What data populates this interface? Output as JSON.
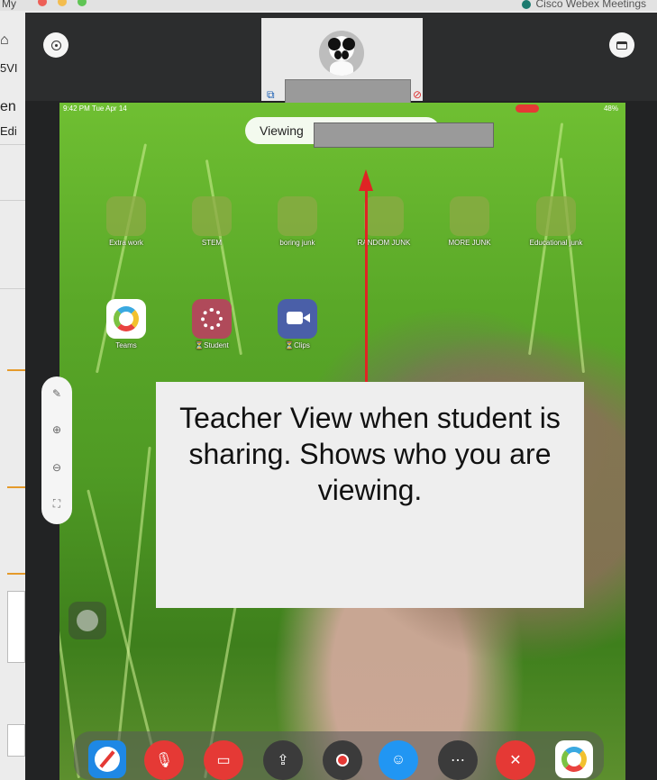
{
  "mac": {
    "app_name": "My",
    "right_title": "Cisco Webex Meetings",
    "side_fragments": [
      "5VI",
      "en",
      "Edi"
    ]
  },
  "participant": {
    "name": ""
  },
  "screen": {
    "status_time": "9:42 PM  Tue Apr 14",
    "status_right": "48%",
    "viewing_prefix": "Viewing"
  },
  "home": {
    "folders": [
      {
        "label": "Extra work"
      },
      {
        "label": "STEM"
      },
      {
        "label": "boring junk"
      },
      {
        "label": "RANDOM JUNK"
      },
      {
        "label": "MORE JUNK"
      },
      {
        "label": "Educational junk"
      }
    ],
    "apps": [
      {
        "label": "Teams"
      },
      {
        "label": "⏳Student"
      },
      {
        "label": "⏳Clips"
      }
    ]
  },
  "annotation": {
    "text": "Teacher View when student is sharing. Shows who you are viewing."
  },
  "colors": {
    "arrow": "#e02424",
    "mute": "#e53935",
    "participants": "#2196f3"
  },
  "icons": [
    "info-icon",
    "layout-icon",
    "share-icon",
    "mute-icon",
    "zoom-in-icon",
    "zoom-out-icon",
    "fit-icon",
    "pen-icon",
    "video-off-icon",
    "share-screen-icon",
    "record-icon",
    "participants-icon",
    "more-icon",
    "leave-icon"
  ]
}
